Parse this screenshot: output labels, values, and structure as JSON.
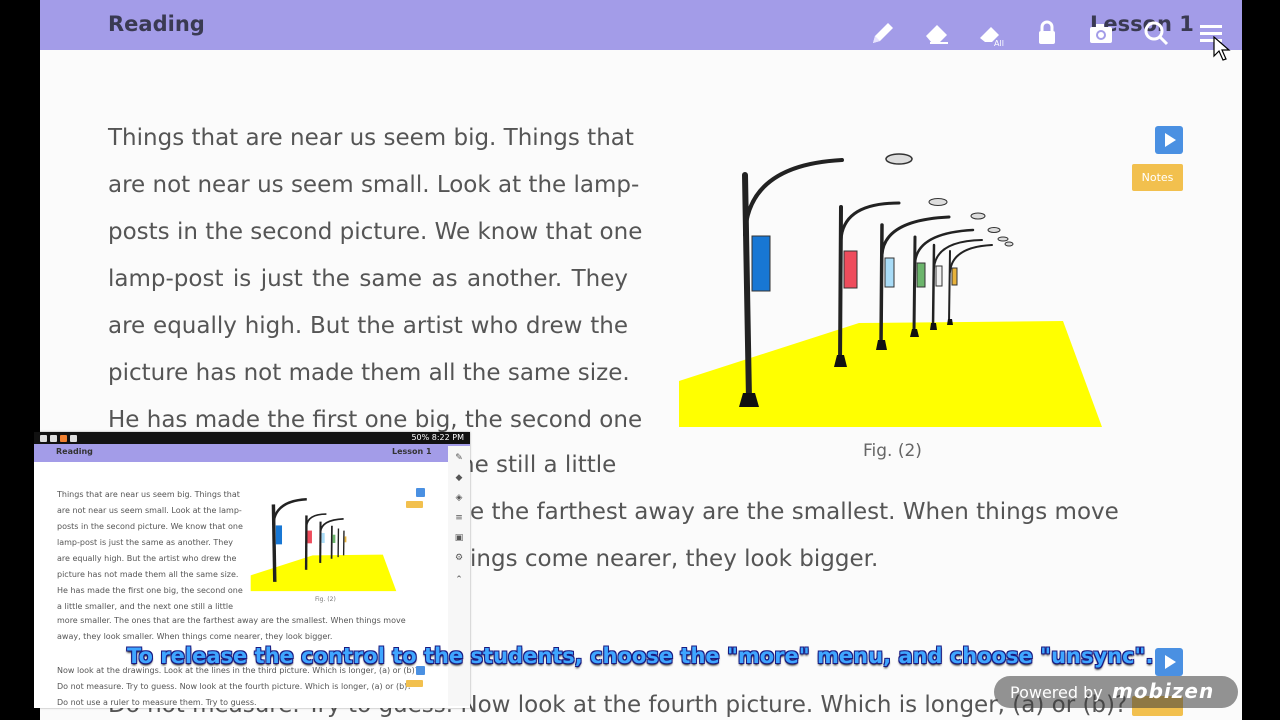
{
  "header": {
    "title": "Reading",
    "lesson": "Lesson 1",
    "tools": [
      "pencil-icon",
      "eraser-icon",
      "erase-all-icon",
      "lock-icon",
      "camera-icon",
      "search-icon",
      "menu-icon"
    ],
    "color": "#a39ce8"
  },
  "passage": {
    "lines": [
      "Things that are near us seem big. Things that",
      "are not near us seem small. Look at the lamp-",
      "posts in the second picture. We know that one",
      "lamp-post is just the same as another. They",
      "are equally high. But the artist who drew the",
      "picture has not made them all the same size.",
      "He has made the first one big, the second one"
    ],
    "partial_line_8": "ne still a little",
    "partial_line_9": "e the farthest away are the smallest. When things move",
    "partial_line_10": "ings come nearer, they look bigger.",
    "bottom_line_1": "Do not measure. Try to guess. Now look at the fourth picture. Which is longer, (a) or (b)?"
  },
  "figure": {
    "caption": "Fig. (2)"
  },
  "notes_label": "Notes",
  "phone": {
    "status_time": "8:22 PM",
    "status_battery": "50%",
    "title": "Reading",
    "lesson": "Lesson 1",
    "lines": [
      "Things that are near us seem big. Things that",
      "are not near us seem small. Look at the lamp-",
      "posts in the second picture. We know that one",
      "lamp-post is just the same as another. They",
      "are equally high. But the artist who drew the",
      "picture has not made them all the same size.",
      "He has made the first one big, the second one",
      "a little smaller, and the next one still a little"
    ],
    "cont_1": "more smaller. The ones that are the farthest away are the smallest. When things move",
    "cont_2": "away, they look smaller. When things come nearer, they look bigger.",
    "q_1": "Now look at the drawings. Look at the lines in the third picture. Which is longer, (a) or (b)?",
    "q_2": "Do not measure. Try to guess. Now look at the fourth picture. Which is longer, (a) or (b)?",
    "q_3": "Do not use a ruler to measure them. Try to guess.",
    "caption": "Fig. (2)"
  },
  "subtitle": "To release the control to the students, choose the \"more\" menu, and choose \"unsync\".",
  "watermark": {
    "text": "Powered by",
    "logo": "mobizen"
  }
}
